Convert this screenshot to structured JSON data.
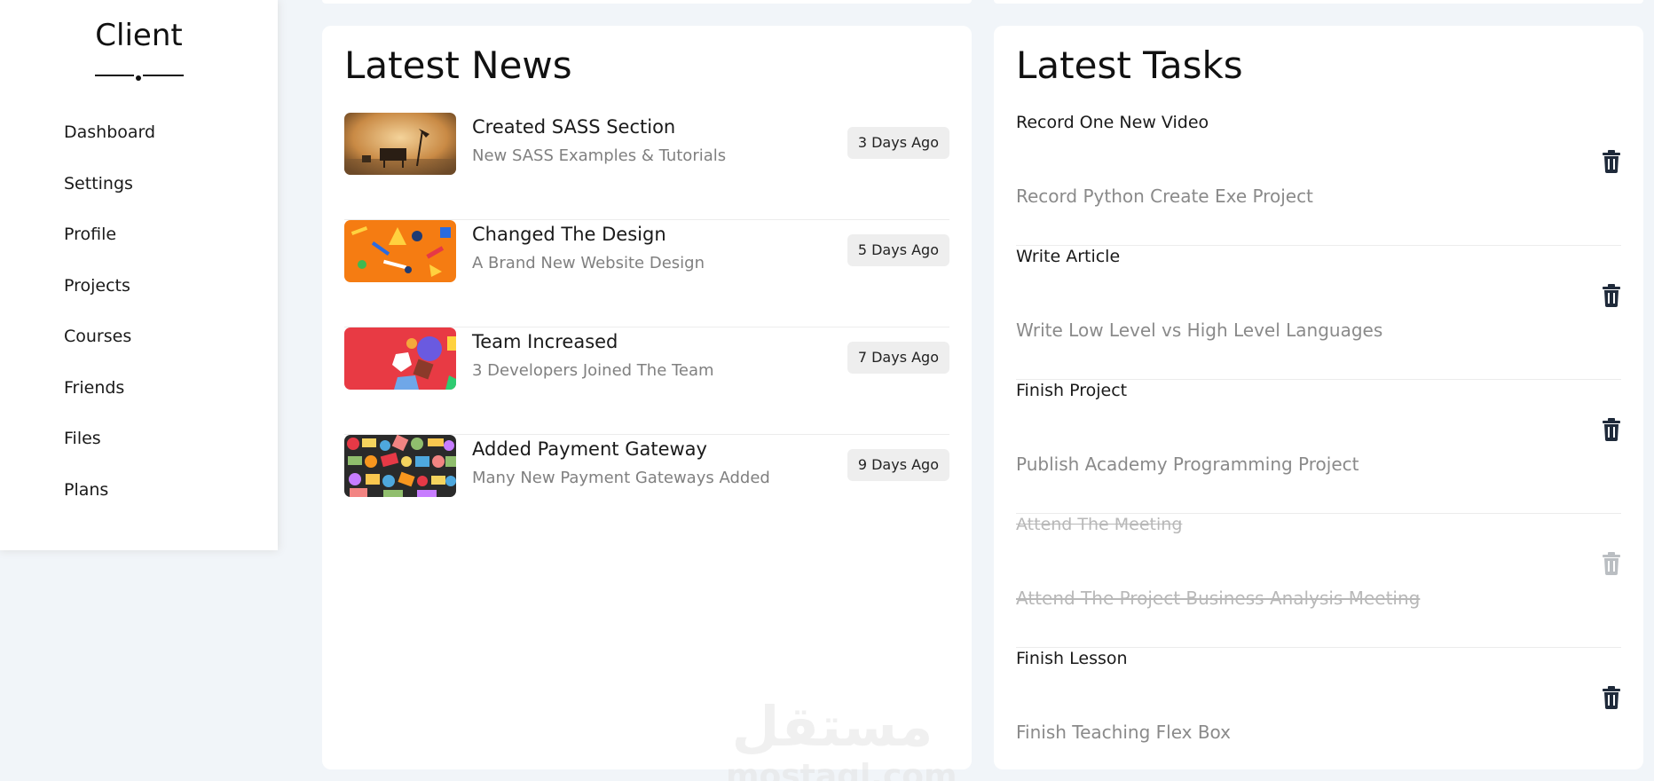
{
  "sidebar": {
    "title": "Client",
    "items": [
      {
        "label": "Dashboard"
      },
      {
        "label": "Settings"
      },
      {
        "label": "Profile"
      },
      {
        "label": "Projects"
      },
      {
        "label": "Courses"
      },
      {
        "label": "Friends"
      },
      {
        "label": "Files"
      },
      {
        "label": "Plans"
      }
    ]
  },
  "news": {
    "title": "Latest News",
    "items": [
      {
        "title": "Created SASS Section",
        "subtitle": "New SASS Examples & Tutorials",
        "badge": "3 Days Ago",
        "image": "desk-lamp-photo"
      },
      {
        "title": "Changed The Design",
        "subtitle": "A Brand New Website Design",
        "badge": "5 Days Ago",
        "image": "stationery-orange-photo"
      },
      {
        "title": "Team Increased",
        "subtitle": "3 Developers Joined The Team",
        "badge": "7 Days Ago",
        "image": "shapes-red-photo"
      },
      {
        "title": "Added Payment Gateway",
        "subtitle": "Many New Payment Gateways Added",
        "badge": "9 Days Ago",
        "image": "doodle-pattern-photo"
      }
    ]
  },
  "tasks": {
    "title": "Latest Tasks",
    "items": [
      {
        "title": "Record One New Video",
        "subtitle": "Record Python Create Exe Project",
        "done": false
      },
      {
        "title": "Write Article",
        "subtitle": "Write Low Level vs High Level Languages",
        "done": false
      },
      {
        "title": "Finish Project",
        "subtitle": "Publish Academy Programming Project",
        "done": false
      },
      {
        "title": "Attend The Meeting",
        "subtitle": "Attend The Project Business Analysis Meeting",
        "done": true
      },
      {
        "title": "Finish Lesson",
        "subtitle": "Finish Teaching Flex Box",
        "done": false
      }
    ]
  },
  "watermark": {
    "arabic": "مستقل",
    "latin": "mostaql.com"
  },
  "colors": {
    "page_bg": "#f1f5f9",
    "panel_bg": "#ffffff",
    "muted_text": "#808080",
    "badge_bg": "#eeeeee"
  }
}
